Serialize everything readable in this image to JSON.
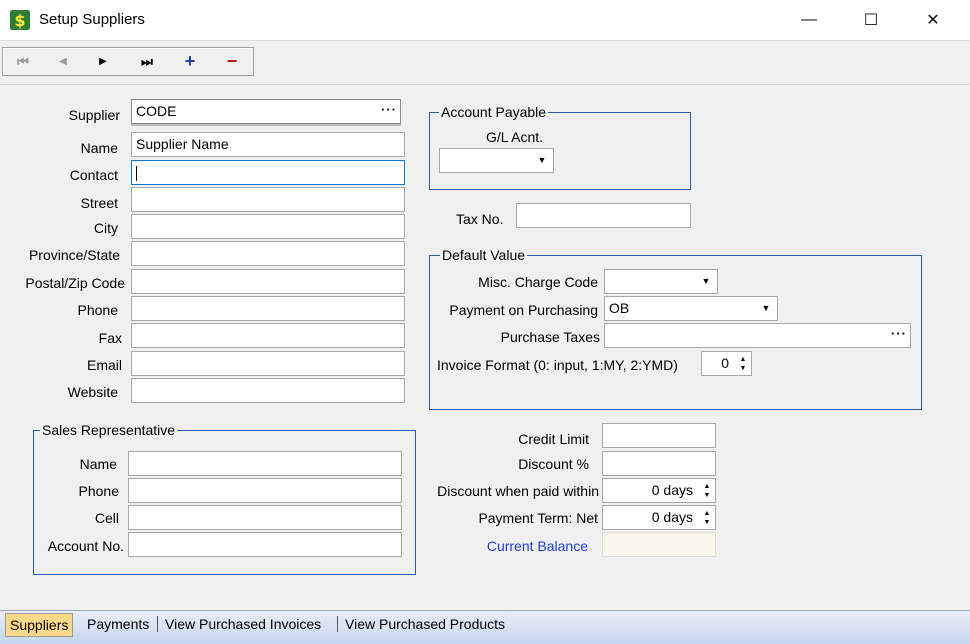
{
  "window": {
    "title": "Setup Suppliers",
    "minimize": "—",
    "maximize": "☐",
    "close": "✕"
  },
  "toolbar": {
    "first": "⏮",
    "prev": "◀",
    "next": "▶",
    "last": "⏭",
    "add": "+",
    "delete": "−"
  },
  "supplier": {
    "supplier_label": "Supplier",
    "supplier_value": "CODE",
    "lookup": "···",
    "name_label": "Name",
    "name_value": "Supplier Name",
    "contact_label": "Contact",
    "contact_value": "",
    "street_label": "Street",
    "street_value": "",
    "city_label": "City",
    "city_value": "",
    "province_label": "Province/State",
    "province_value": "",
    "postal_label": "Postal/Zip Code",
    "postal_value": "",
    "phone_label": "Phone",
    "phone_value": "",
    "fax_label": "Fax",
    "fax_value": "",
    "email_label": "Email",
    "email_value": "",
    "website_label": "Website",
    "website_value": ""
  },
  "sales_rep": {
    "title": "Sales Representative",
    "name_label": "Name",
    "name_value": "",
    "phone_label": "Phone",
    "phone_value": "",
    "cell_label": "Cell",
    "cell_value": "",
    "account_label": "Account No.",
    "account_value": ""
  },
  "account_payable": {
    "title": "Account Payable",
    "gl_label": "G/L Acnt.",
    "gl_value": ""
  },
  "tax": {
    "label": "Tax No.",
    "value": ""
  },
  "default_value": {
    "title": "Default Value",
    "misc_label": "Misc. Charge Code",
    "misc_value": "",
    "payment_label": "Payment on Purchasing",
    "payment_value": "OB",
    "taxes_label": "Purchase Taxes",
    "taxes_value": "",
    "lookup": "···",
    "invoice_label": "Invoice Format (0: input, 1:MY, 2:YMD)",
    "invoice_value": "0"
  },
  "credit": {
    "limit_label": "Credit Limit",
    "limit_value": "",
    "discount_label": "Discount %",
    "discount_value": "",
    "discount_days_label": "Discount when paid within",
    "discount_days_value": "0 days",
    "term_label": "Payment Term: Net",
    "term_value": "0 days",
    "balance_label": "Current Balance",
    "balance_value": ""
  },
  "tabs": [
    "Suppliers",
    "Payments",
    "View Purchased Invoices",
    "View Purchased Products"
  ],
  "colors": {
    "group_border": "#2a5ca8",
    "link": "#1f3ed6",
    "active_tab": "#ffd987"
  }
}
